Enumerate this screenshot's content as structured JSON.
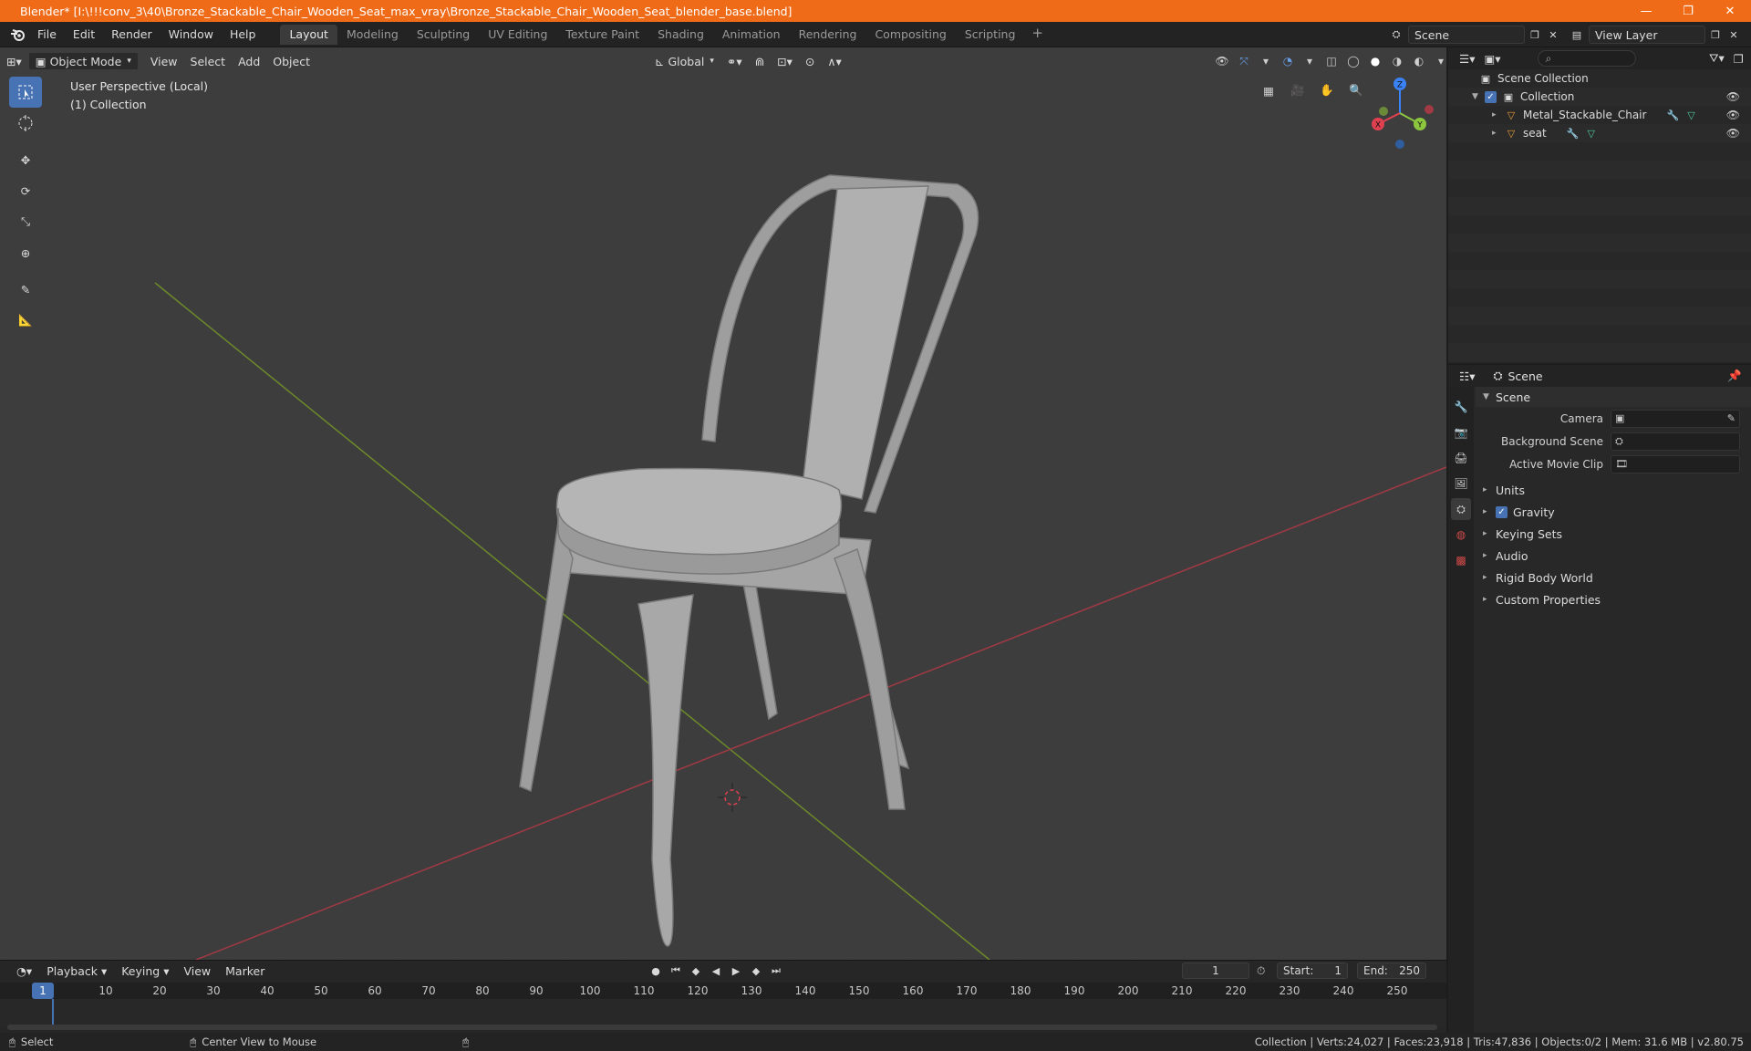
{
  "window": {
    "title": "Blender* [I:\\!!!conv_3\\40\\Bronze_Stackable_Chair_Wooden_Seat_max_vray\\Bronze_Stackable_Chair_Wooden_Seat_blender_base.blend]",
    "minimize": "—",
    "maximize": "❐",
    "close": "✕"
  },
  "menu": [
    "File",
    "Edit",
    "Render",
    "Window",
    "Help"
  ],
  "workspaces": [
    "Layout",
    "Modeling",
    "Sculpting",
    "UV Editing",
    "Texture Paint",
    "Shading",
    "Animation",
    "Rendering",
    "Compositing",
    "Scripting"
  ],
  "active_workspace": "Layout",
  "scene_selector": "Scene",
  "view_layer_selector": "View Layer",
  "viewport": {
    "mode": "Object Mode",
    "menus": [
      "View",
      "Select",
      "Add",
      "Object"
    ],
    "transform_orientation": "Global",
    "info_line1": "User Perspective (Local)",
    "info_line2": "(1) Collection",
    "gizmo_axes": {
      "x": "X",
      "y": "Y",
      "z": "Z"
    },
    "colors": {
      "x_axis": "#e04050",
      "y_axis": "#8cc63f",
      "z_axis": "#3a82f7",
      "active_tool": "#4772b3"
    }
  },
  "tools": [
    "select-box",
    "cursor",
    "move",
    "rotate",
    "scale",
    "transform",
    "annotate",
    "measure"
  ],
  "timeline": {
    "menus": [
      "Playback",
      "Keying",
      "View",
      "Marker"
    ],
    "current_frame": "1",
    "start_label": "Start:",
    "start_value": "1",
    "end_label": "End:",
    "end_value": "250",
    "ticks": [
      "10",
      "20",
      "30",
      "40",
      "50",
      "60",
      "70",
      "80",
      "90",
      "100",
      "110",
      "120",
      "130",
      "140",
      "150",
      "160",
      "170",
      "180",
      "190",
      "200",
      "210",
      "220",
      "230",
      "240",
      "250"
    ],
    "cursor_label": "1"
  },
  "status": {
    "select": "Select",
    "center_view": "Center View to Mouse",
    "stats": "Collection | Verts:24,027 | Faces:23,918 | Tris:47,836 | Objects:0/2 | Mem: 31.6 MB | v2.80.75"
  },
  "outliner": {
    "items": [
      {
        "label": "Scene Collection",
        "level": 0
      },
      {
        "label": "Collection",
        "level": 1
      },
      {
        "label": "Metal_Stackable_Chair",
        "level": 2
      },
      {
        "label": "seat",
        "level": 2
      }
    ]
  },
  "properties": {
    "header": "Scene",
    "panel": "Scene",
    "rows": [
      {
        "label": "Camera"
      },
      {
        "label": "Background Scene"
      },
      {
        "label": "Active Movie Clip"
      }
    ],
    "subpanels": [
      "Units",
      "Gravity",
      "Keying Sets",
      "Audio",
      "Rigid Body World",
      "Custom Properties"
    ]
  }
}
